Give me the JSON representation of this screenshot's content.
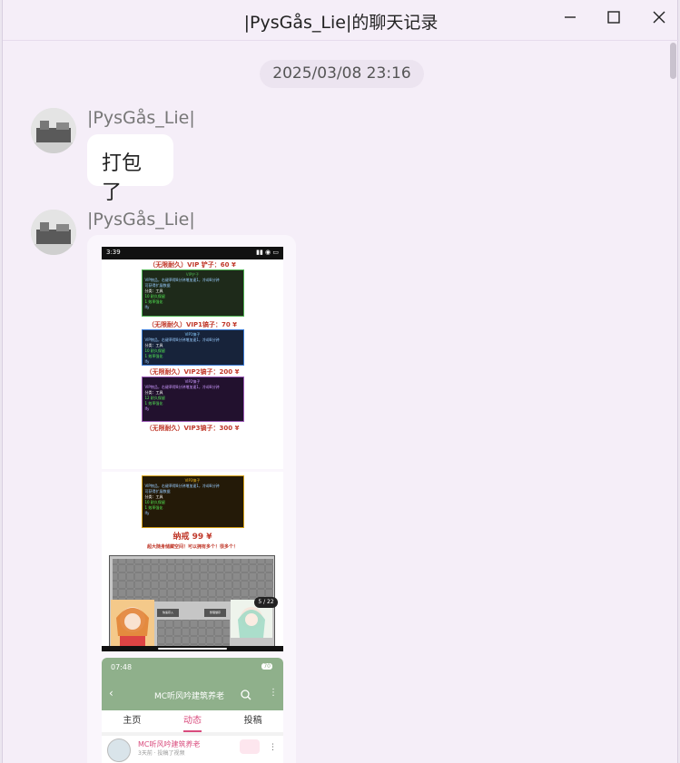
{
  "window": {
    "title": "|PysGås_Lie|的聊天记录",
    "minimize_icon": "minimize-icon",
    "maximize_icon": "maximize-icon",
    "close_icon": "close-icon"
  },
  "timestamp": "2025/03/08 23:16",
  "messages": [
    {
      "sender": "|PysGås_Lie|",
      "text": "打包了"
    },
    {
      "sender": "|PysGås_Lie|"
    }
  ],
  "screenshot1": {
    "time": "3:39",
    "items": [
      {
        "price_label": "（无限耐久）VIP 铲子：60 ¥",
        "box_title": "VIP铲子",
        "box_lines": [
          "VIP物品，右键草得8分钟增加速1，冷却8分钟",
          "可获得扩展数据",
          "分类：工具",
          "10 耐久保留",
          "1 效率强化",
          "Ify"
        ],
        "box_color": "#4caf50"
      },
      {
        "price_label": "（无限耐久）VIP1镐子：70 ¥",
        "box_title": "VIP1镐子",
        "box_lines": [
          "VIP物品，右键草得8分钟增加速1，冷却8分钟",
          "分类：工具",
          "10 耐久保留",
          "1 效率强化",
          "Ify"
        ],
        "box_color": "#3a7bd5"
      },
      {
        "price_label": "（无限耐久）VIP2镐子：200 ¥",
        "box_title": "VIP2镐子",
        "box_lines": [
          "VIP物品，右键草得8分钟增加速1，冷却8分钟",
          "分类：工具",
          "12 耐久保留",
          "1 效率强化",
          "Ify"
        ],
        "box_color": "#9b59b6"
      },
      {
        "price_label": "（无限耐久）VIP3镐子：300 ¥"
      }
    ]
  },
  "screenshot2": {
    "box_title": "VIP3镐子",
    "box_lines": [
      "VIP物品，右键草得8分钟增加速1，冷却8分钟",
      "可获得扩展数据",
      "分类：工具",
      "10 耐久保留",
      "1 效率强化",
      "Ify"
    ],
    "ring_label": "纳戒 99 ¥",
    "ring_desc": "超大随身储藏空间！可以拥有多个！很多个！",
    "page_indicator": "5 / 22",
    "btn1": "快速存入",
    "btn2": "整理储存"
  },
  "screenshot3": {
    "time": "07:48",
    "battery": "70",
    "channel_title": "MC听风吟建筑养老",
    "tabs": [
      "主页",
      "动态",
      "投稿"
    ],
    "active_tab": "动态",
    "post_author": "MC听风吟建筑养老",
    "post_meta": "3天前 · 投稿了视频"
  }
}
